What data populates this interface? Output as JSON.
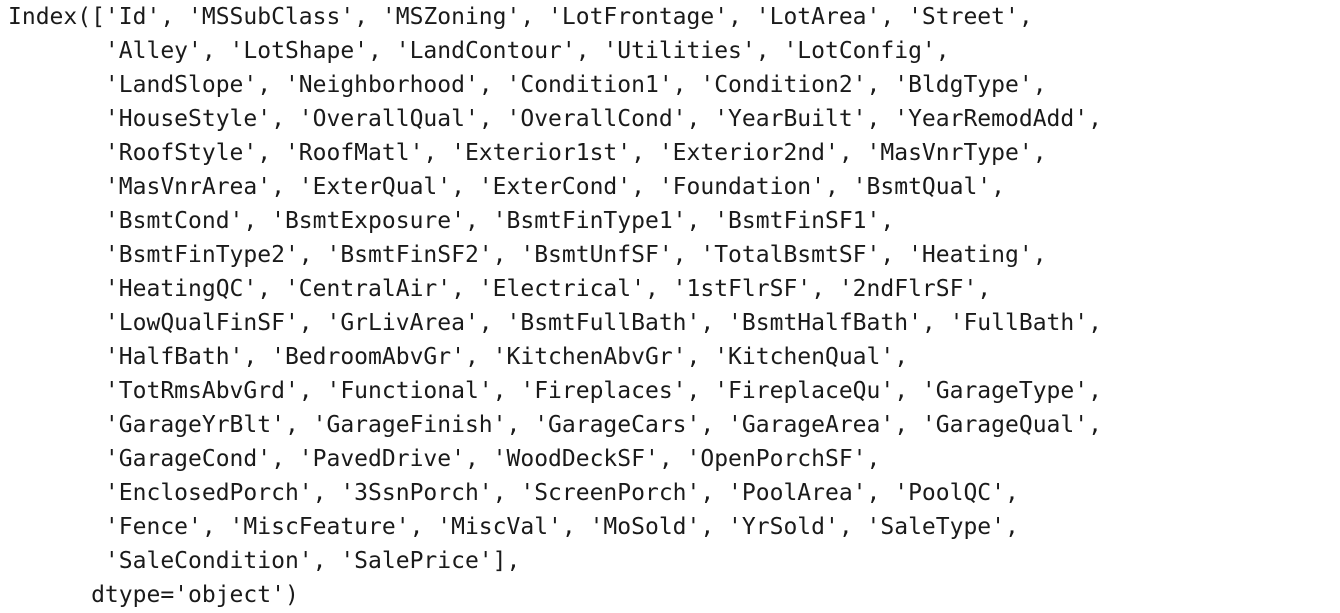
{
  "output": {
    "lines": [
      "Index(['Id', 'MSSubClass', 'MSZoning', 'LotFrontage', 'LotArea', 'Street',",
      "       'Alley', 'LotShape', 'LandContour', 'Utilities', 'LotConfig',",
      "       'LandSlope', 'Neighborhood', 'Condition1', 'Condition2', 'BldgType',",
      "       'HouseStyle', 'OverallQual', 'OverallCond', 'YearBuilt', 'YearRemodAdd',",
      "       'RoofStyle', 'RoofMatl', 'Exterior1st', 'Exterior2nd', 'MasVnrType',",
      "       'MasVnrArea', 'ExterQual', 'ExterCond', 'Foundation', 'BsmtQual',",
      "       'BsmtCond', 'BsmtExposure', 'BsmtFinType1', 'BsmtFinSF1',",
      "       'BsmtFinType2', 'BsmtFinSF2', 'BsmtUnfSF', 'TotalBsmtSF', 'Heating',",
      "       'HeatingQC', 'CentralAir', 'Electrical', '1stFlrSF', '2ndFlrSF',",
      "       'LowQualFinSF', 'GrLivArea', 'BsmtFullBath', 'BsmtHalfBath', 'FullBath',",
      "       'HalfBath', 'BedroomAbvGr', 'KitchenAbvGr', 'KitchenQual',",
      "       'TotRmsAbvGrd', 'Functional', 'Fireplaces', 'FireplaceQu', 'GarageType',",
      "       'GarageYrBlt', 'GarageFinish', 'GarageCars', 'GarageArea', 'GarageQual',",
      "       'GarageCond', 'PavedDrive', 'WoodDeckSF', 'OpenPorchSF',",
      "       'EnclosedPorch', '3SsnPorch', 'ScreenPorch', 'PoolArea', 'PoolQC',",
      "       'Fence', 'MiscFeature', 'MiscVal', 'MoSold', 'YrSold', 'SaleType',",
      "       'SaleCondition', 'SalePrice'],",
      "      dtype='object')"
    ]
  }
}
